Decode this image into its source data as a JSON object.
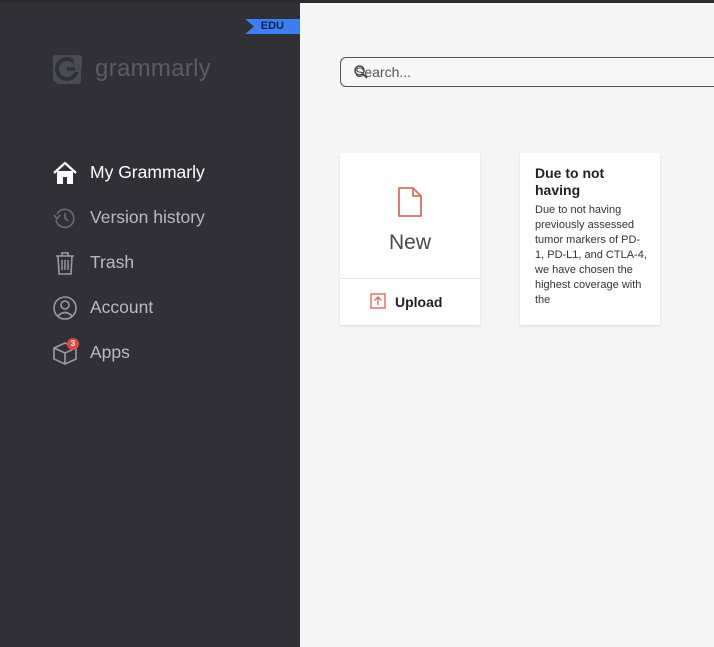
{
  "sidebar": {
    "badge": "EDU",
    "logo_text": "grammarly",
    "items": [
      {
        "label": "My Grammarly",
        "icon": "home-icon"
      },
      {
        "label": "Version history",
        "icon": "history-icon"
      },
      {
        "label": "Trash",
        "icon": "trash-icon"
      },
      {
        "label": "Account",
        "icon": "account-icon"
      },
      {
        "label": "Apps",
        "icon": "apps-box-icon",
        "badge": "3"
      }
    ]
  },
  "search": {
    "placeholder": "Search..."
  },
  "new_card": {
    "label": "New",
    "upload_label": "Upload"
  },
  "documents": [
    {
      "title": "Due to not having",
      "preview": "Due to not having previously assessed tumor markers of PD-1, PD-L1, and CTLA-4, we have chosen the highest coverage with the"
    }
  ],
  "colors": {
    "sidebar": "#303036",
    "accent": "#e06b5f",
    "badge": "#3d7ff0",
    "notification": "#e5483e"
  }
}
